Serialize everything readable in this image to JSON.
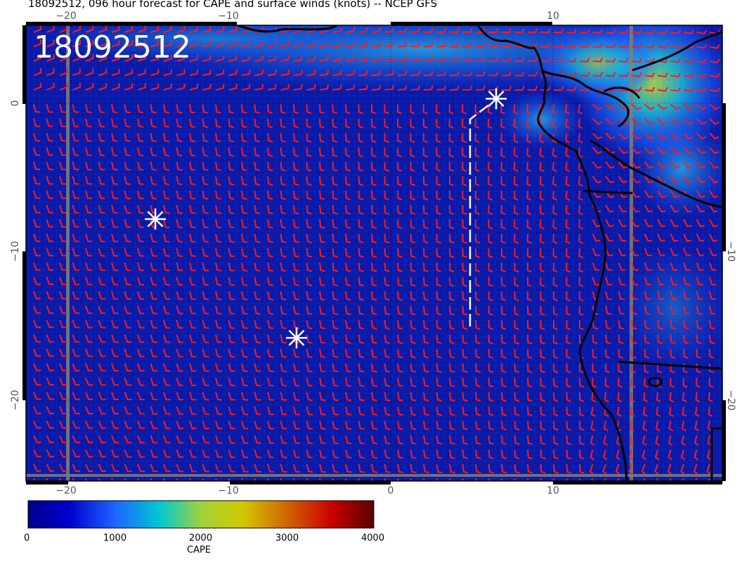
{
  "title": "18092512, 096 hour forecast for CAPE and surface winds (knots) -- NCEP GFS",
  "stamp": "18092512",
  "axes": {
    "lon_ticks": [
      "−20",
      "−10",
      "0",
      "10"
    ],
    "lat_ticks": [
      "0",
      "−10",
      "−20"
    ]
  },
  "colorbar": {
    "label": "CAPE",
    "ticks": [
      "0",
      "1000",
      "2000",
      "3000",
      "4000"
    ],
    "range": [
      0,
      4000
    ],
    "colors": [
      "#00008b",
      "#0000cd",
      "#1e64ff",
      "#00c8d2",
      "#a0d23c",
      "#d2c800",
      "#d26400",
      "#c80000",
      "#5a0000"
    ]
  },
  "colors": {
    "ocean_base": "#0a1aa8",
    "wind_barbs": "#ff1a1a",
    "coastline": "#000000",
    "markers": "#ffffff",
    "track": "#ffffff"
  },
  "markers": [
    {
      "name": "storm-marker-1",
      "lon": 6.5,
      "lat": 0.3
    },
    {
      "name": "storm-marker-2",
      "lon": -14.5,
      "lat": -7.8
    },
    {
      "name": "storm-marker-3",
      "lon": -5.8,
      "lat": -15.8
    }
  ]
}
